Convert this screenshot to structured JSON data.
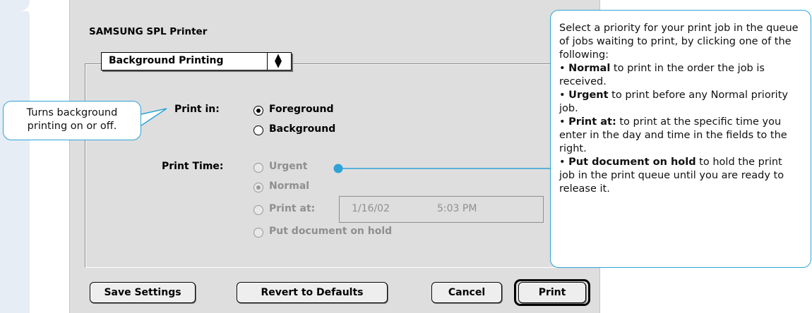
{
  "dialog": {
    "title": "SAMSUNG SPL Printer",
    "panel_popup": {
      "selected": "Background Printing",
      "arrows_glyph": "⬍"
    },
    "print_in": {
      "label": "Print in:",
      "options": [
        {
          "label": "Foreground",
          "selected": true
        },
        {
          "label": "Background",
          "selected": false
        }
      ]
    },
    "print_time": {
      "label": "Print Time:",
      "enabled": false,
      "options": [
        {
          "label": "Urgent",
          "selected": false
        },
        {
          "label": "Normal",
          "selected": true
        },
        {
          "label": "Print at:",
          "selected": false
        },
        {
          "label": "Put document on hold",
          "selected": false
        }
      ],
      "date": "1/16/02",
      "time": "5:03 PM"
    },
    "buttons": {
      "save_settings": "Save Settings",
      "revert": "Revert to Defaults",
      "cancel": "Cancel",
      "print": "Print"
    }
  },
  "callouts": {
    "left": {
      "line1": "Turns background",
      "line2": "printing on or off."
    },
    "right": {
      "intro": "Select a priority for your print job in the queue of jobs waiting to print, by clicking one of the following:",
      "items": [
        {
          "term": "Normal",
          "text": " to print in the order the job is received."
        },
        {
          "term": "Urgent",
          "text": " to print before any Normal priority job."
        },
        {
          "term": "Print at:",
          "text": " to print at the specific time you enter in the day and time in the fields to the right."
        },
        {
          "term": "Put document on hold",
          "text": " to hold the print job in the print queue until you are ready to release it."
        }
      ],
      "bullet": "•"
    }
  },
  "colors": {
    "accent": "#2ea3d8",
    "dialog_bg": "#dedede",
    "side_band": "#e6edf5",
    "disabled_text": "#8f8f8f"
  }
}
